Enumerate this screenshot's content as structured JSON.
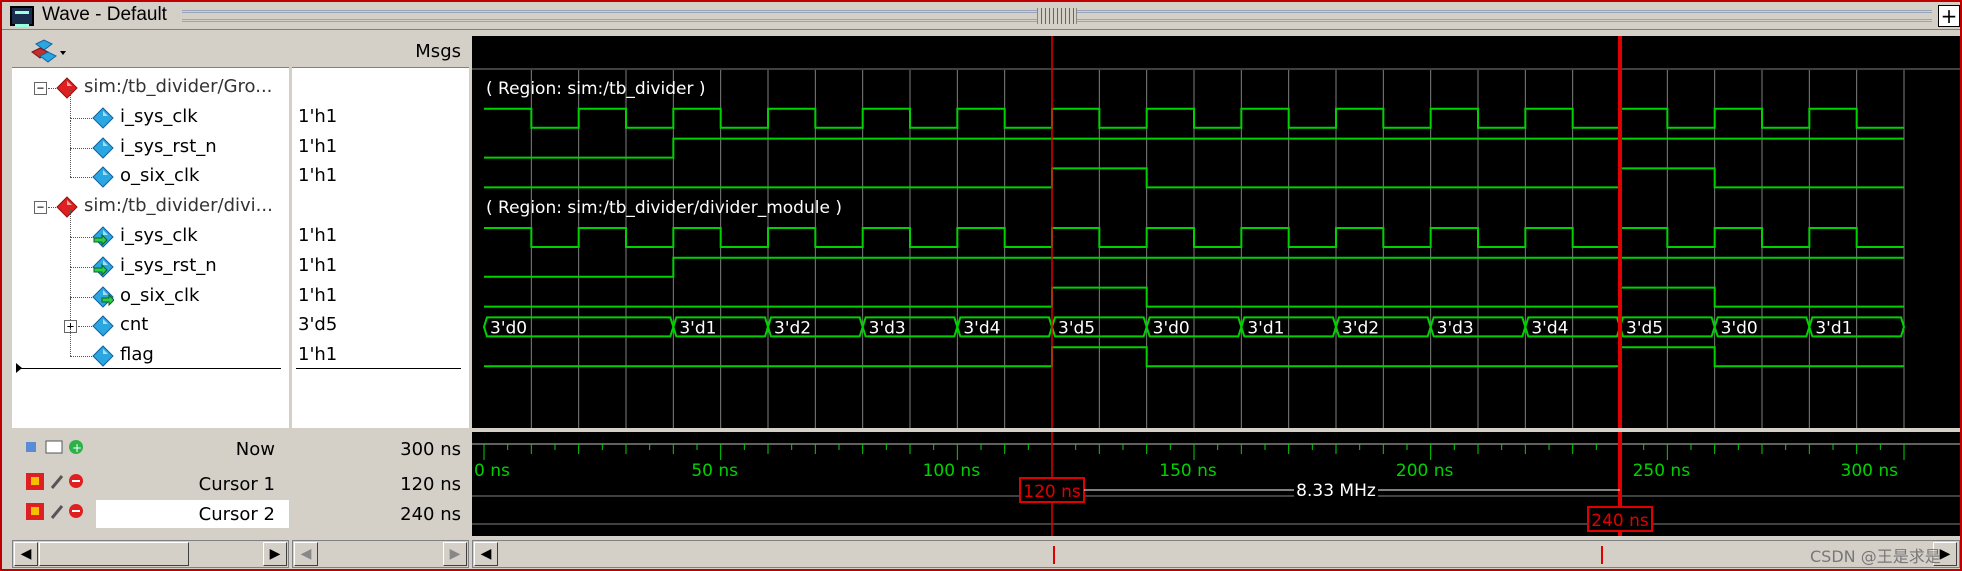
{
  "window": {
    "title": "Wave - Default"
  },
  "header": {
    "msgs_label": "Msgs"
  },
  "signals": [
    {
      "name": "sim:/tb_divider/Gro...",
      "value": "",
      "kind": "group",
      "expanded": true
    },
    {
      "name": "i_sys_clk",
      "value": "1'h1",
      "kind": "signal"
    },
    {
      "name": "i_sys_rst_n",
      "value": "1'h1",
      "kind": "signal"
    },
    {
      "name": "o_six_clk",
      "value": "1'h1",
      "kind": "signal"
    },
    {
      "name": "sim:/tb_divider/divi...",
      "value": "",
      "kind": "group",
      "expanded": true
    },
    {
      "name": "i_sys_clk",
      "value": "1'h1",
      "kind": "input"
    },
    {
      "name": "i_sys_rst_n",
      "value": "1'h1",
      "kind": "input"
    },
    {
      "name": "o_six_clk",
      "value": "1'h1",
      "kind": "output"
    },
    {
      "name": "cnt",
      "value": "3'd5",
      "kind": "bus",
      "expanded": false
    },
    {
      "name": "flag",
      "value": "1'h1",
      "kind": "signal"
    }
  ],
  "regions": [
    {
      "label": "( Region: sim:/tb_divider )"
    },
    {
      "label": "( Region: sim:/tb_divider/divider_module )"
    }
  ],
  "cnt_values": [
    "3'd0",
    "3'd1",
    "3'd2",
    "3'd3",
    "3'd4",
    "3'd5",
    "3'd0",
    "3'd1",
    "3'd2",
    "3'd3",
    "3'd4",
    "3'd5",
    "3'd0",
    "3'd1"
  ],
  "timeline": {
    "now_label": "Now",
    "now_value": "300 ns",
    "ticks": [
      "0 ns",
      "50 ns",
      "100 ns",
      "150 ns",
      "200 ns",
      "250 ns",
      "300 ns"
    ],
    "range_ns": [
      0,
      300
    ]
  },
  "cursors": [
    {
      "label": "Cursor 1",
      "value": "120 ns",
      "time_ns": 120,
      "tag": "120 ns"
    },
    {
      "label": "Cursor 2",
      "value": "240 ns",
      "time_ns": 240,
      "tag": "240 ns"
    }
  ],
  "cursor_delta": "8.33 MHz",
  "watermark": "CSDN @王是求是",
  "colors": {
    "wave": "#00d200",
    "cursor": "#e00000",
    "grid": "#808080",
    "text": "#ffffff"
  },
  "icons": {
    "group": "red-diamond-icon",
    "signal": "blue-diamond-icon",
    "input": "input-diamond-icon",
    "output": "output-diamond-icon"
  }
}
